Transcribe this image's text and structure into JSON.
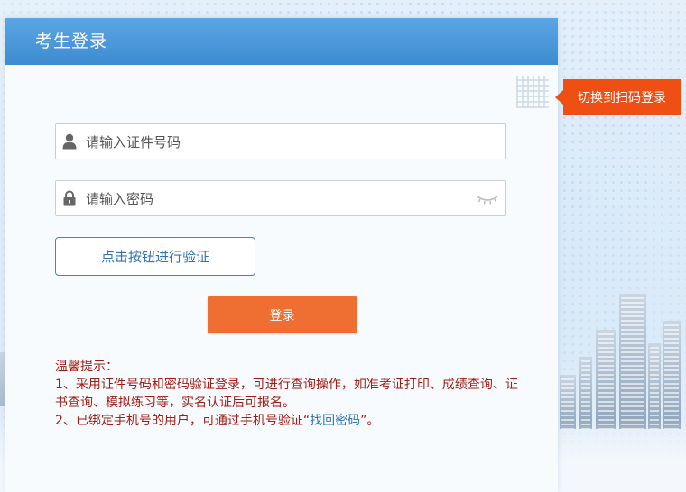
{
  "header": {
    "title": "考生登录"
  },
  "switch_tab": {
    "label": "切换到扫码登录"
  },
  "form": {
    "id_field": {
      "placeholder": "请输入证件号码",
      "value": ""
    },
    "password_field": {
      "placeholder": "请输入密码",
      "value": ""
    },
    "verify_button": "点击按钮进行验证",
    "login_button": "登录"
  },
  "tips": {
    "title": "温馨提示：",
    "line1": "1、采用证件号码和密码验证登录，可进行查询操作，如准考证打印、成绩查询、证书查询、模拟练习等，实名认证后可报名。",
    "line2_prefix": "2、已绑定手机号的用户，可通过手机号验证“",
    "line2_link": "找回密码",
    "line2_suffix": "”。"
  },
  "colors": {
    "header_blue": "#3d8bd1",
    "login_orange": "#ef6f33",
    "switch_orange": "#ef4f12",
    "tip_red": "#a31c14",
    "link_blue": "#2f74b5"
  },
  "icons": [
    "user-icon",
    "lock-icon",
    "eye-closed-icon"
  ]
}
